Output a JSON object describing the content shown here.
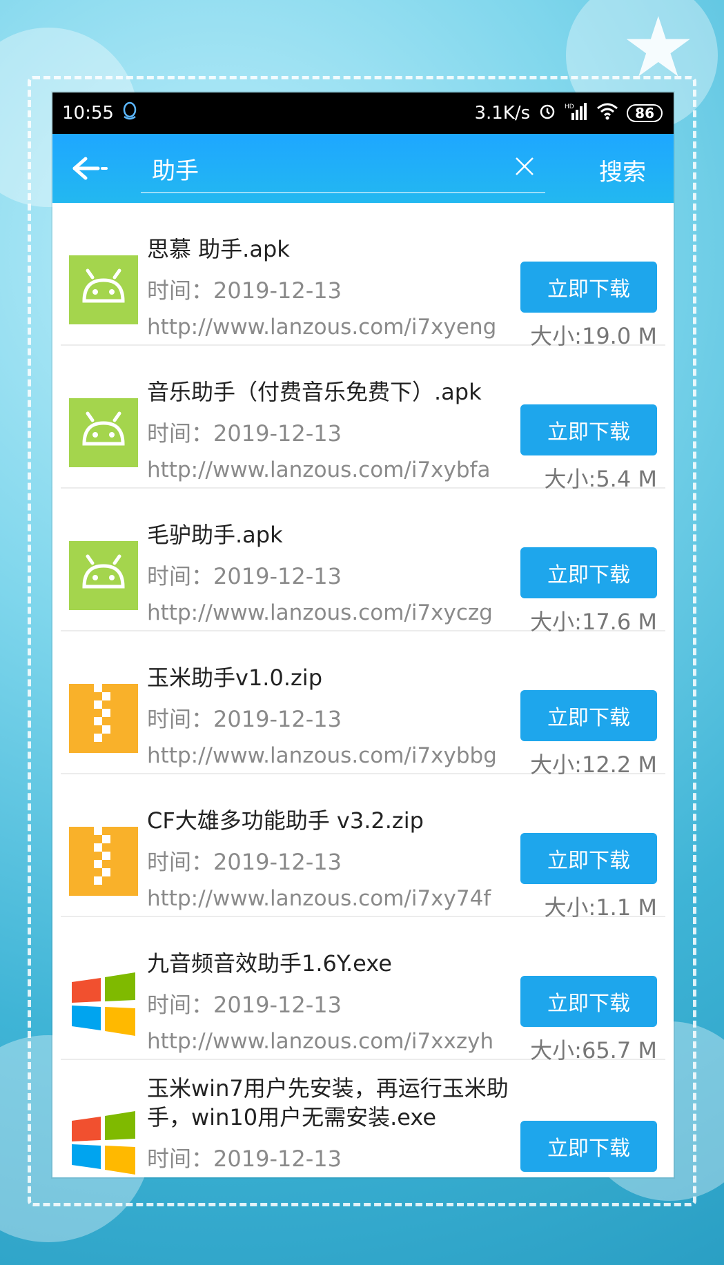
{
  "status_bar": {
    "time": "10:55",
    "network_speed": "3.1K/s",
    "battery": "86"
  },
  "search": {
    "query": "助手",
    "submit_label": "搜索"
  },
  "items": [
    {
      "name": "思慕 助手.apk",
      "time": "时间：2019-12-13",
      "url": "http://www.lanzous.com/i7xyeng",
      "size": "大小:19.0 M",
      "icon": "android-icon",
      "button": "立即下载"
    },
    {
      "name": "音乐助手（付费音乐免费下）.apk",
      "time": "时间：2019-12-13",
      "url": "http://www.lanzous.com/i7xybfa",
      "size": "大小:5.4 M",
      "icon": "android-icon",
      "button": "立即下载"
    },
    {
      "name": "毛驴助手.apk",
      "time": "时间：2019-12-13",
      "url": "http://www.lanzous.com/i7xyczg",
      "size": "大小:17.6 M",
      "icon": "android-icon",
      "button": "立即下载"
    },
    {
      "name": "玉米助手v1.0.zip",
      "time": "时间：2019-12-13",
      "url": "http://www.lanzous.com/i7xybbg",
      "size": "大小:12.2 M",
      "icon": "zip-icon",
      "button": "立即下载"
    },
    {
      "name": "CF大雄多功能助手 v3.2.zip",
      "time": "时间：2019-12-13",
      "url": "http://www.lanzous.com/i7xy74f",
      "size": "大小:1.1 M",
      "icon": "zip-icon",
      "button": "立即下载"
    },
    {
      "name": "九音频音效助手1.6Y.exe",
      "time": "时间：2019-12-13",
      "url": "http://www.lanzous.com/i7xxzyh",
      "size": "大小:65.7 M",
      "icon": "windows-icon",
      "button": "立即下载"
    },
    {
      "name": "玉米win7用户先安装，再运行玉米助手，win10用户无需安装.exe",
      "time": "时间：2019-12-13",
      "button": "立即下载",
      "icon": "windows-icon"
    }
  ],
  "colors": {
    "header": "#1ea7ff",
    "button": "#1ea6ec",
    "android": "#a4d54d",
    "zip": "#f9b12a"
  }
}
